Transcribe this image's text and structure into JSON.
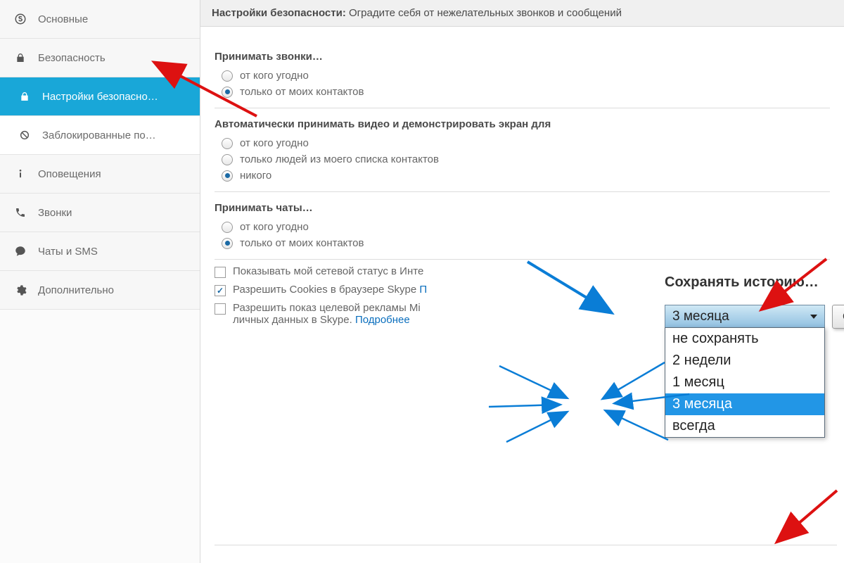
{
  "sidebar": {
    "general": "Основные",
    "security": "Безопасность",
    "security_settings": "Настройки безопасно…",
    "blocked": "Заблокированные по…",
    "notifications": "Оповещения",
    "calls": "Звонки",
    "chats_sms": "Чаты и SMS",
    "advanced": "Дополнительно"
  },
  "header": {
    "title": "Настройки безопасности:",
    "subtitle": "Оградите себя от нежелательных звонков и сообщений"
  },
  "sections": {
    "calls_label": "Принимать звонки…",
    "calls_opt1": "от кого угодно",
    "calls_opt2": "только от моих контактов",
    "video_label": "Автоматически принимать видео и демонстрировать экран для",
    "video_opt1": "от кого угодно",
    "video_opt2": "только людей из моего списка контактов",
    "video_opt3": "никого",
    "chats_label": "Принимать чаты…",
    "chats_opt1": "от кого угодно",
    "chats_opt2": "только от моих контактов"
  },
  "checks": {
    "status": "Показывать мой сетевой статус в Инте",
    "cookies_a": "Разрешить Cookies в браузере Skype ",
    "cookies_b": "П",
    "ads_a": "Разрешить показ целевой рекламы Mi",
    "ads_b": "личных данных в Skype. ",
    "ads_link": "Подробнее"
  },
  "history": {
    "title": "Сохранять историю…",
    "selected": "3 месяца",
    "options": [
      "не сохранять",
      "2 недели",
      "1 месяц",
      "3 месяца",
      "всегда"
    ],
    "clear_btn": "Очистить историю"
  }
}
